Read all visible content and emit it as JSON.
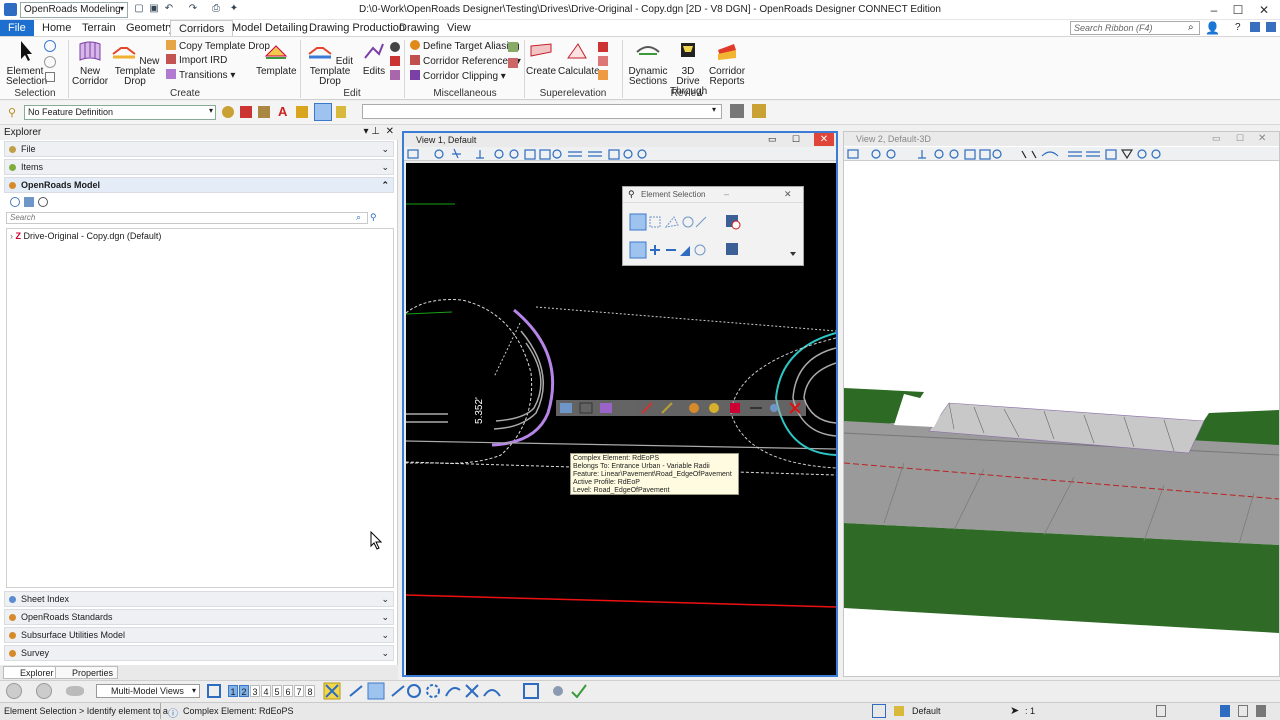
{
  "app": {
    "workspace": "OpenRoads Modeling",
    "window_title": "D:\\0-Work\\OpenRoads Designer\\Testing\\Drives\\Drive-Original - Copy.dgn [2D - V8 DGN] - OpenRoads Designer CONNECT Edition"
  },
  "menu": {
    "tabs": [
      "File",
      "Home",
      "Terrain",
      "Geometry",
      "Corridors",
      "Model Detailing",
      "Drawing Production",
      "Drawing",
      "View"
    ],
    "active": "Corridors",
    "search_placeholder": "Search Ribbon (F4)"
  },
  "ribbon": {
    "selection": {
      "label": "Selection",
      "element_selection": "Element\nSelection"
    },
    "create": {
      "label": "Create",
      "new_corridor": "New\nCorridor",
      "new_template_drop": "New\nTemplate Drop",
      "copy_template_drop": "Copy Template Drop",
      "import_ird": "Import IRD",
      "transitions": "Transitions",
      "template": "Template"
    },
    "edit": {
      "label": "Edit",
      "edit_template_drop": "Edit\nTemplate Drop",
      "edits": "Edits"
    },
    "misc": {
      "label": "Miscellaneous",
      "define_target_aliasing": "Define Target Aliasing",
      "corridor_references": "Corridor References",
      "corridor_clipping": "Corridor Clipping"
    },
    "superelevation": {
      "label": "Superelevation",
      "create": "Create",
      "calculate": "Calculate"
    },
    "review": {
      "label": "Review",
      "dynamic_sections": "Dynamic\nSections",
      "drive_through": "3D Drive\nThrough",
      "corridor_reports": "Corridor\nReports"
    }
  },
  "toolbar2": {
    "feature_definition": "No Feature Definition"
  },
  "explorer": {
    "title": "Explorer",
    "sections_top": [
      "File",
      "Items",
      "OpenRoads Model"
    ],
    "search_placeholder": "Search",
    "tree_item": "Drive-Original - Copy.dgn (Default)",
    "sections_bottom": [
      "Sheet Index",
      "OpenRoads Standards",
      "Subsurface Utilities Model",
      "Survey"
    ],
    "bottom_tabs": [
      "Explorer",
      "Properties"
    ]
  },
  "view1": {
    "title": "View 1, Default",
    "dimension": "5.352'"
  },
  "view2": {
    "title": "View 2, Default-3D"
  },
  "element_selection": {
    "title": "Element Selection"
  },
  "tooltip": {
    "lines": [
      "Complex Element: RdEoPS",
      "Belongs To: Entrance Urban - Variable Radii",
      "Feature: Linear\\Pavement\\Road_EdgeOfPavement",
      "Active Profile: RdEoP",
      "Level: Road_EdgeOfPavement"
    ]
  },
  "bottom": {
    "multi_model_views": "Multi-Model Views",
    "view_numbers": [
      "1",
      "2",
      "3",
      "4",
      "5",
      "6",
      "7",
      "8"
    ]
  },
  "status": {
    "prompt": "Element Selection > Identify element to a",
    "message": "Complex Element: RdEoPS",
    "level": "Default",
    "count": ": 1"
  },
  "colors": {
    "accent": "#1d6fcf",
    "view_border": "#3a7bd5",
    "canvas": "#000000"
  }
}
